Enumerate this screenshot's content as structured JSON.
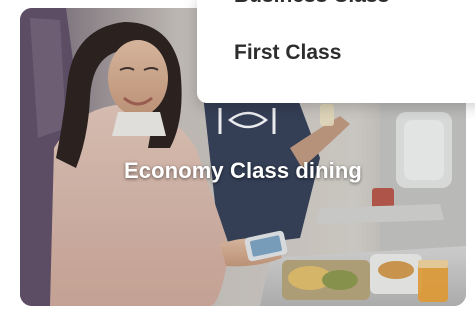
{
  "card": {
    "caption": "Economy Class dining",
    "image_description": "economy-class-dining-photo",
    "logo_icon": "airline-logo-icon"
  },
  "dropdown": {
    "items": [
      {
        "label": "Business Class"
      },
      {
        "label": "First Class"
      }
    ]
  },
  "colors": {
    "menu_text": "#2d2d2d",
    "caption_text": "#ffffff",
    "background": "#ffffff"
  }
}
